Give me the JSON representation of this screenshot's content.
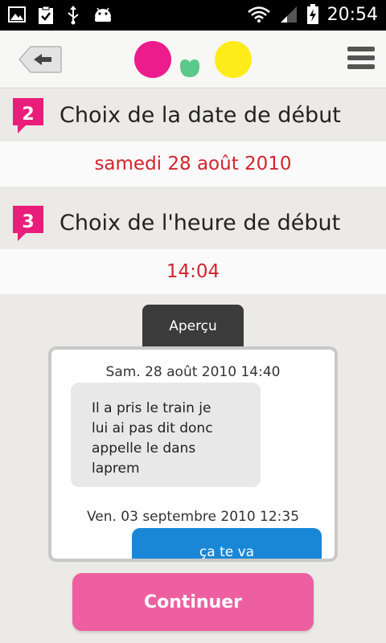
{
  "status_bar": {
    "time": "20:54",
    "left_icons": [
      "image-icon",
      "clipboard-check-icon",
      "usb-icon",
      "android-icon"
    ],
    "right_icons": [
      "wifi-icon",
      "signal-icon",
      "battery-charging-icon"
    ]
  },
  "header": {
    "back_icon": "back-arrow-icon",
    "menu_icon": "hamburger-menu-icon",
    "logo_colors": {
      "pink": "#ec1c8d",
      "green": "#5cc88a",
      "yellow": "#ffec1a"
    }
  },
  "steps": [
    {
      "number": "2",
      "title": "Choix de la date de début",
      "value": "samedi 28 août 2010"
    },
    {
      "number": "3",
      "title": "Choix de l'heure de début",
      "value": "14:04"
    }
  ],
  "preview": {
    "tab_label": "Aperçu",
    "messages": [
      {
        "timestamp": "Sam. 28 août 2010 14:40",
        "text": "Il a pris le train je\nlui ai pas dit donc\nappelle le dans\nlaprem",
        "direction": "in"
      },
      {
        "timestamp": "Ven. 03 septembre 2010 12:35",
        "text": "ça te va",
        "direction": "out"
      }
    ]
  },
  "continue_label": "Continuer",
  "colors": {
    "accent_pink": "#ee5fa1",
    "value_red": "#d1252e",
    "bubble_blue": "#1a87d6",
    "badge_pink": "#e91e7a"
  }
}
